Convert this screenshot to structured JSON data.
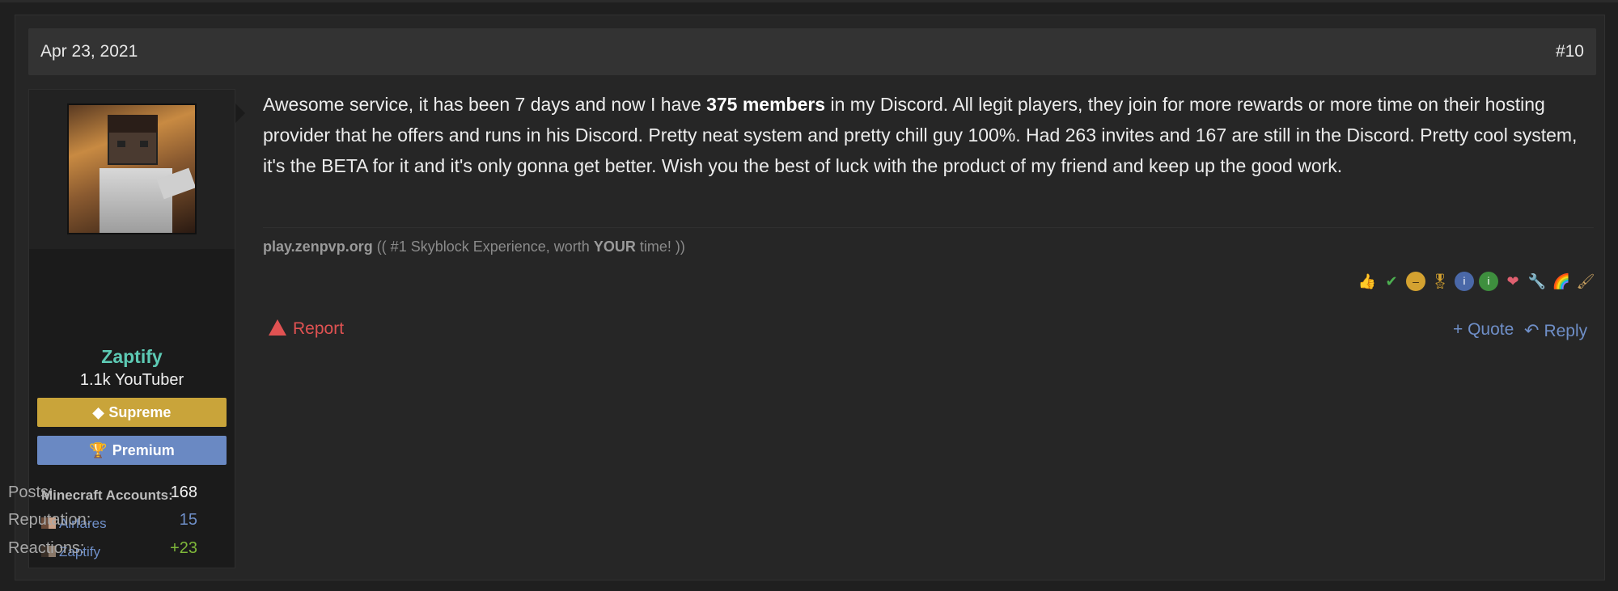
{
  "post": {
    "date": "Apr 23, 2021",
    "number": "#10"
  },
  "user": {
    "name": "Zaptify",
    "title": "1.1k YouTuber",
    "badges": [
      "Supreme",
      "Premium"
    ],
    "mc_heading": "Minecraft Accounts:",
    "mc_accounts": [
      "Airfares",
      "Zaptify"
    ],
    "stats": {
      "posts_label": "Posts:",
      "posts": "168",
      "rep_label": "Reputation:",
      "rep": "15",
      "reactions_label": "Reactions:",
      "reactions": "+23"
    }
  },
  "message": {
    "part1": "Awesome service, it has been 7 days and now I have ",
    "bold": "375 members",
    "part2": " in my Discord. All legit players, they join for more rewards or more time on their hosting provider that he offers and runs in his Discord. Pretty neat system and pretty chill guy 100%. Had 263 invites and 167 are still in the Discord. Pretty cool system, it's the BETA for it and it's only gonna get better. Wish you the best of luck with the product of my friend and keep up the good work."
  },
  "signature": {
    "server": "play.zenpvp.org",
    "pre": " (( #1 Skyblock Experience, worth ",
    "emph": "YOUR",
    "post": " time! ))"
  },
  "reactions": [
    "thumbs-up",
    "check",
    "no-entry",
    "medal",
    "info",
    "info-green",
    "heart",
    "wrench",
    "rainbow",
    "brush"
  ],
  "actions": {
    "report": "Report",
    "quote": "+ Quote",
    "reply": "Reply"
  }
}
